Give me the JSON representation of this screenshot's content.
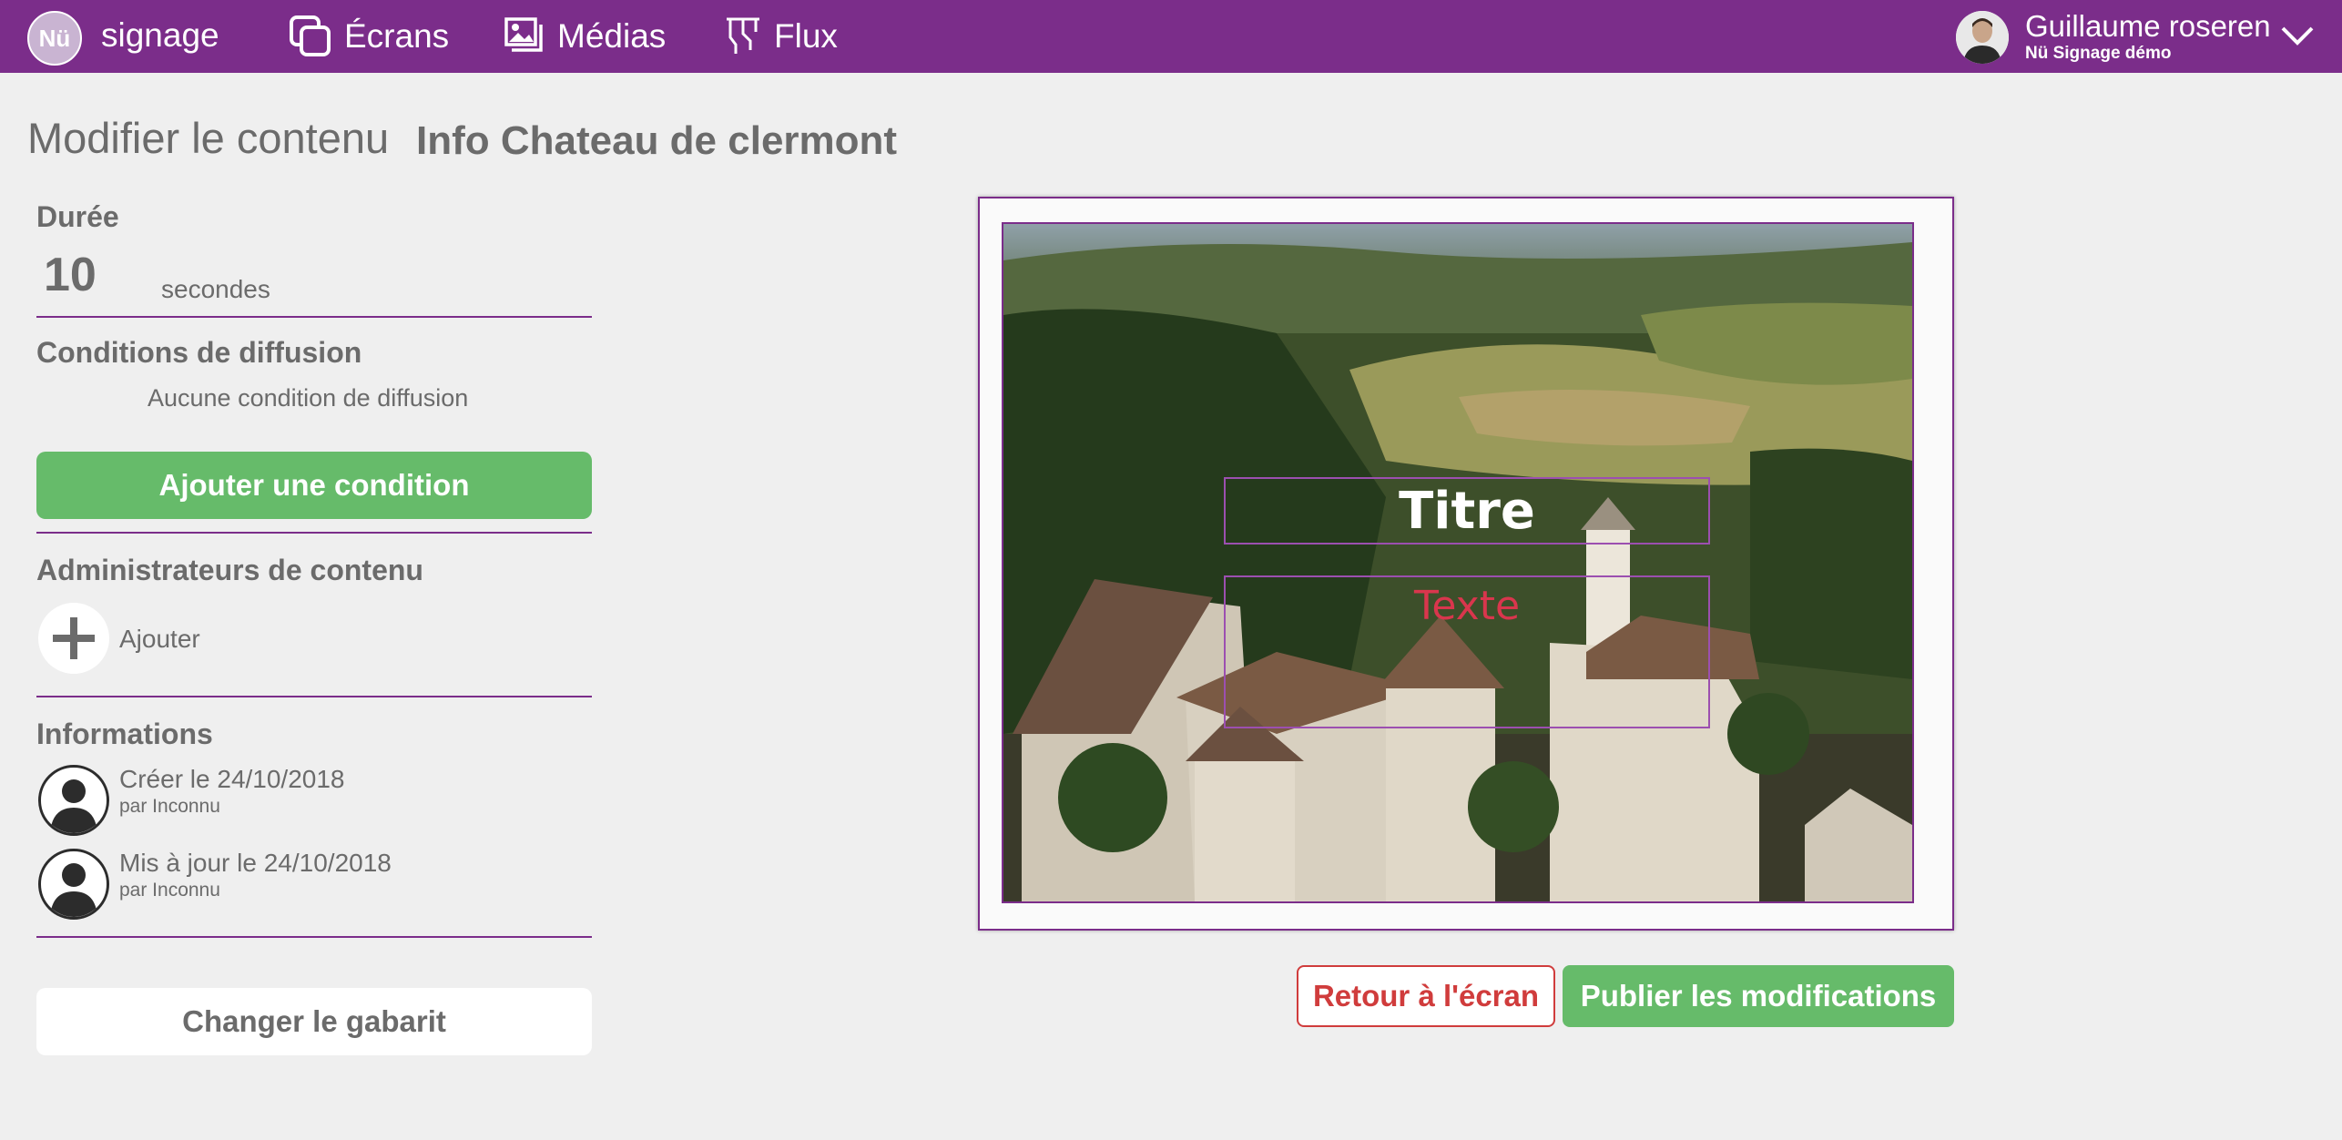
{
  "colors": {
    "brand": "#7b2d8a",
    "success": "#66bb6a",
    "danger": "#d03c3c",
    "text": "#6b6b6b"
  },
  "header": {
    "logo_text": "Nü",
    "brand": "signage",
    "nav": [
      {
        "label": "Écrans",
        "icon": "screens-icon"
      },
      {
        "label": "Médias",
        "icon": "media-icon"
      },
      {
        "label": "Flux",
        "icon": "flux-icon"
      }
    ],
    "user": {
      "name": "Guillaume roseren",
      "org": "Nü Signage démo"
    }
  },
  "page": {
    "title": "Modifier le contenu",
    "content_name": "Info Chateau de clermont"
  },
  "duration": {
    "label": "Durée",
    "value": "10",
    "unit": "secondes"
  },
  "conditions": {
    "label": "Conditions de diffusion",
    "empty_text": "Aucune condition de diffusion",
    "add_button": "Ajouter une condition"
  },
  "admins": {
    "label": "Administrateurs de contenu",
    "add_label": "Ajouter"
  },
  "informations": {
    "label": "Informations",
    "entries": [
      {
        "main": "Créer le 24/10/2018",
        "sub": "par Inconnu"
      },
      {
        "main": "Mis à jour le 24/10/2018",
        "sub": "par Inconnu"
      }
    ]
  },
  "template_button": "Changer le gabarit",
  "preview": {
    "title_zone": "Titre",
    "text_zone": "Texte"
  },
  "actions": {
    "back": "Retour à l'écran",
    "publish": "Publier les modifications"
  }
}
